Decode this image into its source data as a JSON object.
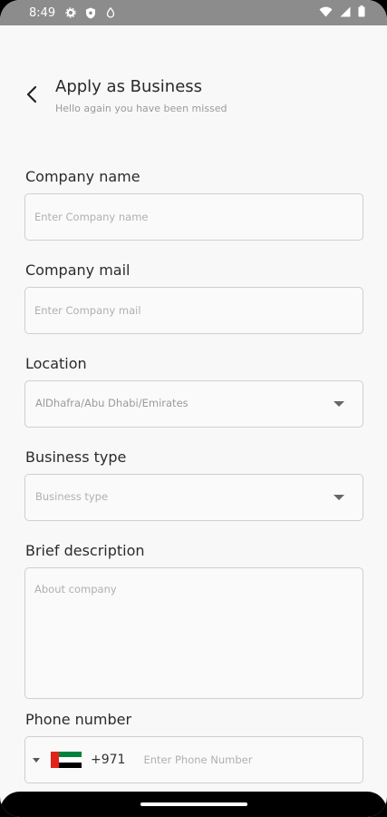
{
  "status_bar": {
    "time": "8:49"
  },
  "header": {
    "title": "Apply as Business",
    "subtitle": "Hello again you have been missed"
  },
  "form": {
    "company_name": {
      "label": "Company name",
      "placeholder": "Enter Company name"
    },
    "company_mail": {
      "label": "Company mail",
      "placeholder": "Enter Company mail"
    },
    "location": {
      "label": "Location",
      "value": "AlDhafra/Abu Dhabi/Emirates"
    },
    "business_type": {
      "label": "Business type",
      "placeholder": "Business type"
    },
    "description": {
      "label": "Brief description",
      "placeholder": "About company"
    },
    "phone": {
      "label": "Phone number",
      "dial_code": "+971",
      "placeholder": "Enter Phone Number",
      "country_flag": "uae-flag-icon"
    }
  },
  "colors": {
    "background": "#f8f8f8",
    "status_bar": "#8c8c8c",
    "border": "#cfcfcf"
  }
}
